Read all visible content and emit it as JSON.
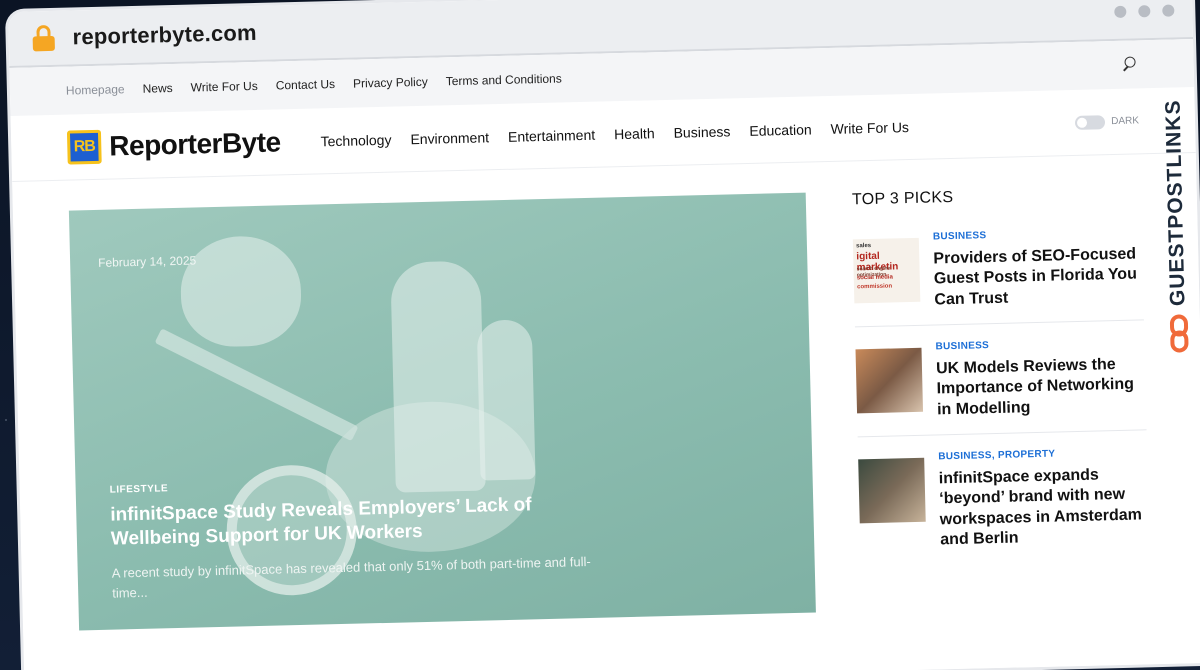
{
  "browser": {
    "url": "reporterbyte.com"
  },
  "topbar": {
    "links": [
      "Homepage",
      "News",
      "Write For Us",
      "Contact Us",
      "Privacy Policy",
      "Terms and Conditions"
    ]
  },
  "header": {
    "logo_mark": "RB",
    "logo_text": "ReporterByte",
    "nav": [
      "Technology",
      "Environment",
      "Entertainment",
      "Health",
      "Business",
      "Education",
      "Write For Us"
    ],
    "dark_toggle_label": "DARK"
  },
  "hero": {
    "date": "February 14, 2025",
    "category": "LIFESTYLE",
    "title": "infinitSpace Study Reveals Employers’ Lack of Wellbeing Support for UK Workers",
    "excerpt": "A recent study by infinitSpace has revealed that only 51% of both part-time and full-time..."
  },
  "sidebar": {
    "heading": "TOP 3 PICKS",
    "thumb1_words": [
      "sales",
      "igital marketin",
      "search engine optimization",
      "social media",
      "commission"
    ],
    "picks": [
      {
        "categories": "BUSINESS",
        "title": "Providers of SEO-Focused Guest Posts in Florida You Can Trust"
      },
      {
        "categories": "BUSINESS",
        "title": "UK Models Reviews the Importance of Networking in Modelling"
      },
      {
        "categories": "BUSINESS, PROPERTY",
        "title": "infinitSpace expands ‘beyond’ brand with new workspaces in Amsterdam and Berlin"
      }
    ]
  },
  "badge": {
    "text": "GUESTPOSTLINKS"
  },
  "colors": {
    "accent_blue": "#1d6fd6",
    "logo_blue": "#1d5fd1",
    "logo_yellow": "#f6c21c",
    "badge_orange": "#f06a3a",
    "lock": "#f5a623"
  }
}
